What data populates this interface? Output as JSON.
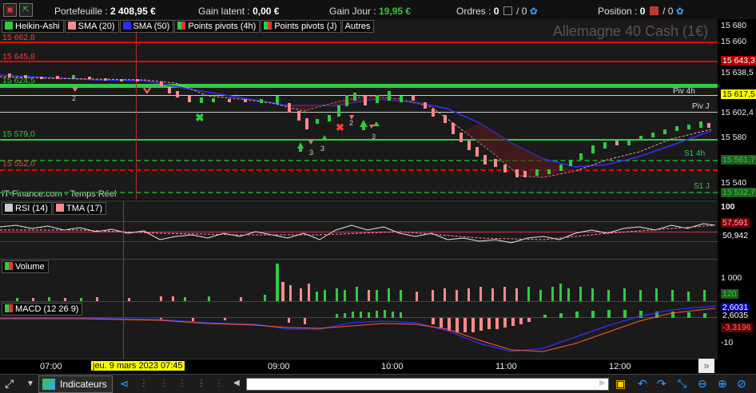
{
  "header": {
    "portfolio_label": "Portefeuille :",
    "portfolio_value": "2 408,95 €",
    "latent_label": "Gain latent :",
    "latent_value": "0,00 €",
    "day_label": "Gain Jour :",
    "day_value": "19,95 €",
    "orders_label": "Ordres :",
    "orders_value": "0",
    "orders_sep": "/ 0",
    "position_label": "Position :",
    "position_value": "0",
    "position_sep": "/ 0"
  },
  "main_chart": {
    "instrument": "Allemagne 40 Cash (1€)",
    "watermark": "IT-Finance.com - Temps Réel",
    "tabs": [
      "Heikin-Ashi",
      "SMA (20)",
      "SMA (50)",
      "Points pivots (4h)",
      "Points pivots (J)",
      "Autres"
    ],
    "tab_colors": [
      "#2ecc40",
      "#ff8a8a",
      "#2b2bff",
      "#2ecc40",
      "#2ecc40",
      ""
    ],
    "levels_left": [
      {
        "text": "15 662,8",
        "color": "#ff3b3b"
      },
      {
        "text": "15 645,8",
        "color": "#ff3b3b"
      },
      {
        "text": "15 624,5",
        "color": "#2ecc40"
      },
      {
        "text": "15 579,0",
        "color": "#2ecc40"
      },
      {
        "text": "15 552,0",
        "color": "#ff3b3b"
      }
    ],
    "pivot_labels": [
      "Piv 4h",
      "Piv J",
      "S1 4h",
      "S1 J"
    ],
    "axis_ticks": [
      "15 680",
      "15 660",
      "15 638,5",
      "15 602,4",
      "15 580",
      "15 540"
    ],
    "axis_tags": [
      {
        "text": "15 643,3",
        "bg": "#b00000",
        "fg": "#fff"
      },
      {
        "text": "15 617,5",
        "bg": "#ffff00",
        "fg": "#000"
      },
      {
        "text": "15 561,7",
        "bg": "#1f5f1f",
        "fg": "#2ecc40"
      },
      {
        "text": "15 532,7",
        "bg": "#1f5f1f",
        "fg": "#2ecc40"
      }
    ],
    "signal_numbers": [
      "2",
      "3",
      "3",
      "2",
      "3"
    ]
  },
  "rsi": {
    "tabs": [
      "RSI (14)",
      "TMA (17)"
    ],
    "axis_ticks": [
      "100"
    ],
    "axis_tags": [
      {
        "text": "57,591",
        "bg": "#7a0000",
        "fg": "#ffb0b0"
      },
      {
        "text": "50,942",
        "bg": "#000",
        "fg": "#fff"
      }
    ]
  },
  "volume": {
    "tabs": [
      "Volume"
    ],
    "axis_ticks": [
      "1 000"
    ],
    "axis_tags": [
      {
        "text": "120",
        "bg": "#1f5f1f",
        "fg": "#2ecc40"
      }
    ]
  },
  "macd": {
    "tabs": [
      "MACD (12 26 9)"
    ],
    "axis_ticks": [
      "-10"
    ],
    "axis_tags": [
      {
        "text": "2,6031",
        "bg": "#0000aa",
        "fg": "#fff"
      },
      {
        "text": "2,6035",
        "bg": "#000",
        "fg": "#fff"
      },
      {
        "text": "-3,3196",
        "bg": "#600000",
        "fg": "#ff7070"
      }
    ]
  },
  "time_axis": {
    "ticks": [
      "07:00",
      "09:00",
      "10:00",
      "11:00",
      "12:00"
    ],
    "cursor_label": "jeu. 9 mars 2023 07:45"
  },
  "toolbar": {
    "indicators_label": "Indicateurs"
  }
}
